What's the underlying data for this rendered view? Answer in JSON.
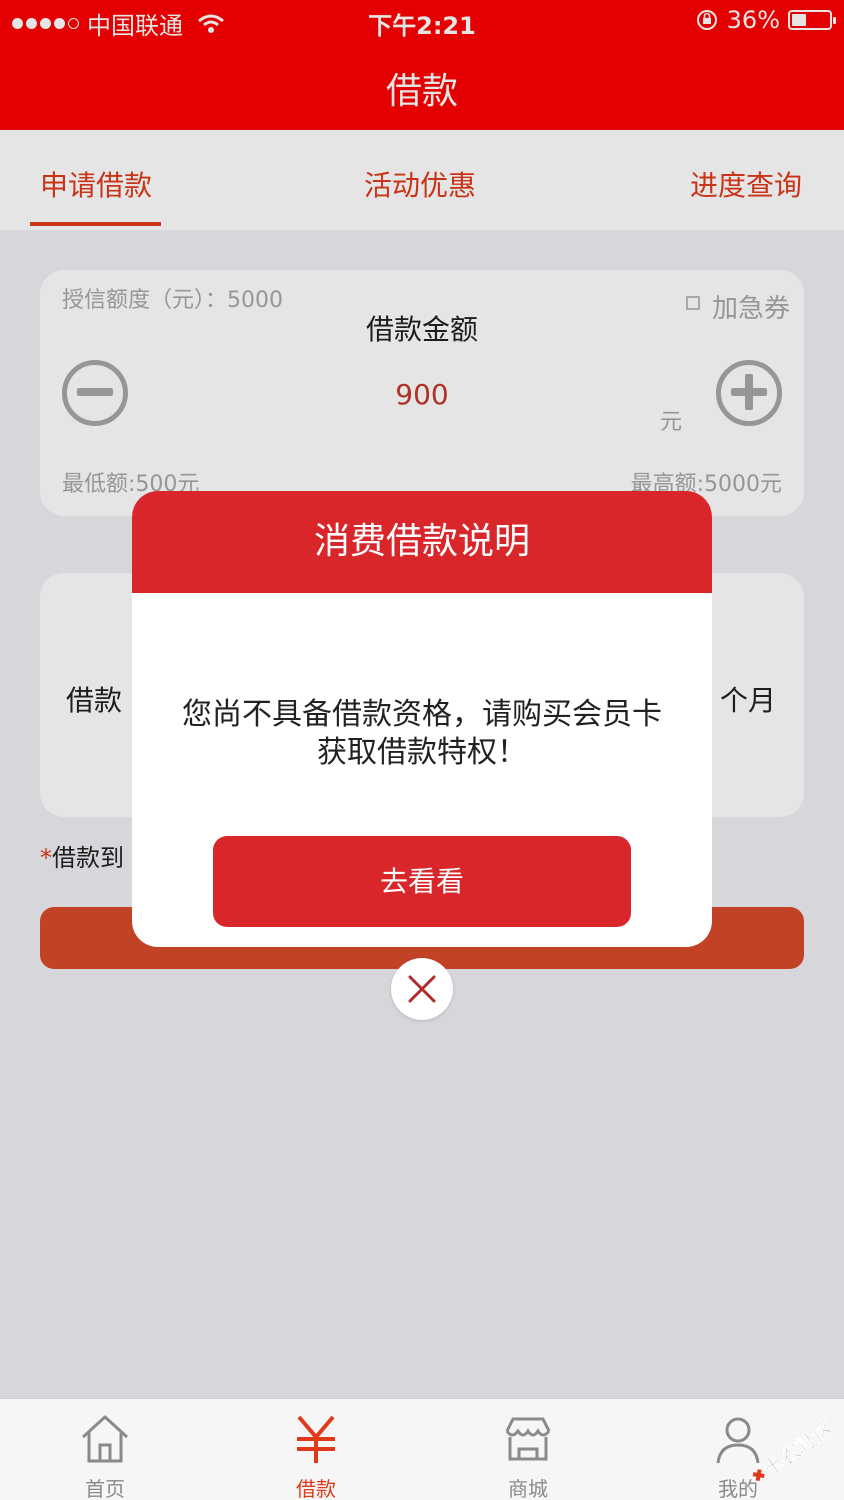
{
  "status": {
    "carrier": "中国联通",
    "time": "下午2:21",
    "battery": "36%"
  },
  "nav": {
    "title": "借款"
  },
  "tabs": [
    {
      "label": "申请借款",
      "active": true
    },
    {
      "label": "活动优惠",
      "active": false
    },
    {
      "label": "进度查询",
      "active": false
    }
  ],
  "credit": {
    "limit_text": "授信额度（元）：5000",
    "amount_title": "借款金额",
    "amount_value": "900",
    "unit": "元",
    "coupon": "加急券",
    "min_text": "最低额:500元",
    "max_text": "最高额:5000元"
  },
  "term": {
    "left_label": "借款",
    "right_label": "个月"
  },
  "note": {
    "asterisk": "*",
    "text": "借款到"
  },
  "modal": {
    "title": "消费借款说明",
    "message_line1": "您尚不具备借款资格，请购买会员卡",
    "message_line2": "获取借款特权！",
    "button": "去看看"
  },
  "tabbar": [
    {
      "label": "首页",
      "icon": "home-icon"
    },
    {
      "label": "借款",
      "icon": "yen-icon",
      "active": true
    },
    {
      "label": "商城",
      "icon": "store-icon"
    },
    {
      "label": "我的",
      "icon": "user-icon"
    }
  ],
  "watermark": "卡农社区",
  "colors": {
    "header_red": "#fe0000",
    "accent": "#e03a1a",
    "modal_red": "#d9262a",
    "background": "#efeff4"
  }
}
